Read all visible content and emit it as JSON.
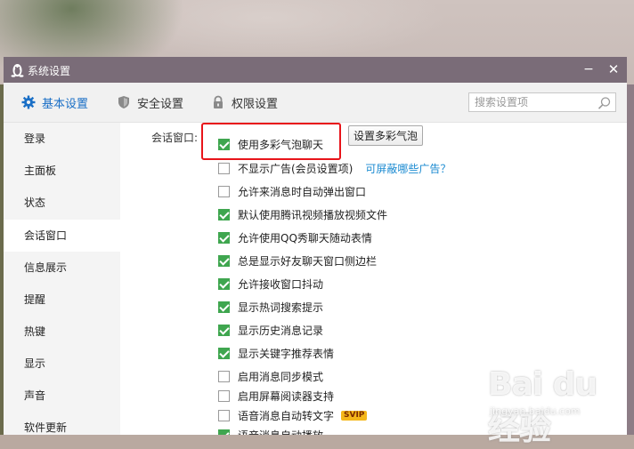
{
  "window": {
    "title": "系统设置",
    "minimize_glyph": "−",
    "close_glyph": "✕"
  },
  "tabs": [
    {
      "label": "基本设置",
      "icon": "gear-icon",
      "active": true
    },
    {
      "label": "安全设置",
      "icon": "shield-icon",
      "active": false
    },
    {
      "label": "权限设置",
      "icon": "lock-icon",
      "active": false
    }
  ],
  "search": {
    "placeholder": "搜索设置项",
    "value": ""
  },
  "sidebar": {
    "items": [
      {
        "label": "登录"
      },
      {
        "label": "主面板"
      },
      {
        "label": "状态"
      },
      {
        "label": "会话窗口",
        "active": true
      },
      {
        "label": "信息展示"
      },
      {
        "label": "提醒"
      },
      {
        "label": "热键"
      },
      {
        "label": "显示"
      },
      {
        "label": "声音"
      },
      {
        "label": "软件更新"
      }
    ]
  },
  "section": {
    "label": "会话窗口:",
    "bubble_button": "设置多彩气泡",
    "options": [
      {
        "label": "使用多彩气泡聊天",
        "checked": true
      },
      {
        "label": "不显示广告(会员设置项)",
        "checked": false,
        "link": "可屏蔽哪些广告？"
      },
      {
        "label": "允许来消息时自动弹出窗口",
        "checked": false
      },
      {
        "label": "默认使用腾讯视频播放视频文件",
        "checked": true
      },
      {
        "label": "允许使用QQ秀聊天随动表情",
        "checked": true
      },
      {
        "label": "总是显示好友聊天窗口侧边栏",
        "checked": true
      },
      {
        "label": "允许接收窗口抖动",
        "checked": true
      },
      {
        "label": "显示热词搜索提示",
        "checked": true
      },
      {
        "label": "显示历史消息记录",
        "checked": true
      },
      {
        "label": "显示关键字推荐表情",
        "checked": true
      },
      {
        "label": "启用消息同步模式",
        "checked": false
      },
      {
        "label": "启用屏幕阅读器支持",
        "checked": false
      },
      {
        "label": "语音消息自动转文字",
        "checked": false,
        "badge": "SVIP"
      },
      {
        "label": "语音消息自动播放",
        "checked": true
      }
    ]
  },
  "watermark": {
    "main": "Bai du 经验",
    "sub": "jingyan.baidu.com"
  },
  "colors": {
    "accent": "#1a6fc6",
    "checkbox_checked": "#3fa64f",
    "titlebar": "#7a6c78",
    "highlight": "#e8141a",
    "link": "#1a8ad1"
  }
}
